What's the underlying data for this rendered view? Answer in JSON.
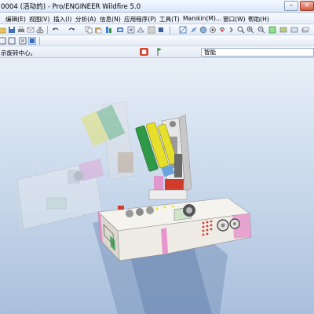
{
  "window": {
    "title": "0004 (活动的) - Pro/ENGINEER Wildfire 5.0",
    "minimize_glyph": "–",
    "close_glyph": "×"
  },
  "menu": [
    "编辑(E)",
    "视图(V)",
    "插入(I)",
    "分析(A)",
    "信息(N)",
    "应用程序(P)",
    "工具(T)",
    "Manikin(M)...",
    "窗口(W)",
    "帮助(H)"
  ],
  "status": {
    "message": "示旋转中心。",
    "filter_value": "智能"
  },
  "toolbar": {
    "icons": [
      "open-icon",
      "save-icon",
      "print-icon",
      "email-icon",
      "cut-icon",
      "undo-icon",
      "redo-icon",
      "copy-icon",
      "paste-icon",
      "regenerate-icon",
      "repaint-icon",
      "zoom-in-icon",
      "zoom-out-icon",
      "refit-icon",
      "orient-icon",
      "datum-plane-icon",
      "datum-axis-icon",
      "datum-point-icon",
      "csys-icon",
      "help-icon"
    ]
  },
  "colors": {
    "titlebar": "#dbe8f8",
    "viewport_top": "#e8eff8",
    "viewport_bottom": "#aac0dc",
    "model_white": "#f4f2ee",
    "model_pink": "#e58cc9",
    "model_green": "#2e9a48",
    "model_yellow": "#e7e02a",
    "model_blue": "#3b7fd6",
    "model_red": "#d23b2a"
  }
}
